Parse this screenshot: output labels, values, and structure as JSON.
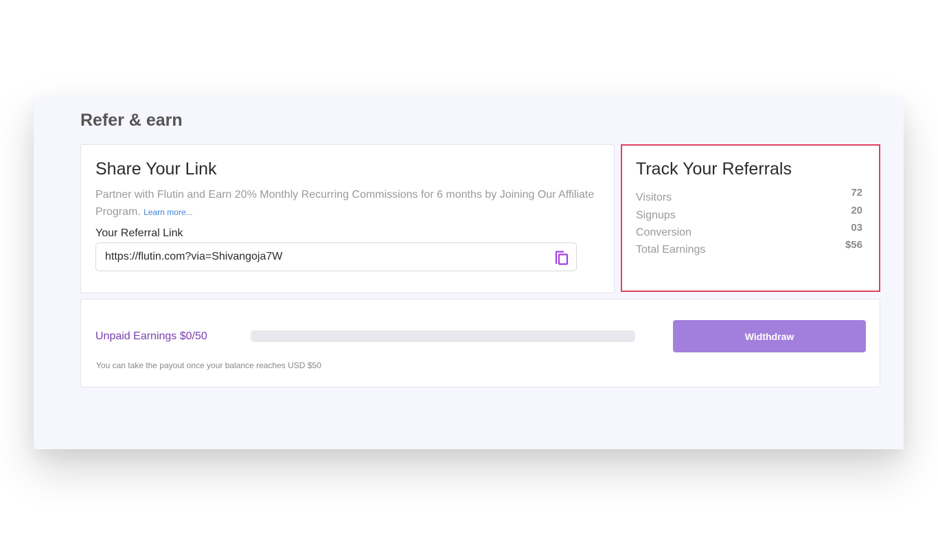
{
  "page": {
    "title": "Refer & earn"
  },
  "share": {
    "title": "Share Your Link",
    "description": "Partner with Flutin and Earn 20% Monthly Recurring Commissions for 6 months by Joining Our Affiliate Program.",
    "learn_more": "Learn more...",
    "link_label": "Your Referral Link",
    "link_value": "https://flutin.com?via=Shivangoja7W",
    "copy_icon": "copy-icon"
  },
  "track": {
    "title": "Track Your Referrals",
    "stats": [
      {
        "label": "Visitors",
        "value": "72"
      },
      {
        "label": "Signups",
        "value": "20"
      },
      {
        "label": "Conversion",
        "value": "03"
      },
      {
        "label": "Total Earnings",
        "value": "$56"
      }
    ]
  },
  "earnings": {
    "unpaid_label": "Unpaid Earnings $0/50",
    "progress_fraction": 0,
    "withdraw_label": "Widthdraw",
    "payout_note": "You can take the payout once your balance reaches USD $50"
  },
  "colors": {
    "panel_background": "#f6f7fe",
    "accent_purple": "#a27fdc",
    "unpaid_text": "#7a3fb0",
    "highlight_border": "#e0405f",
    "link_blue": "#3b82d6"
  }
}
